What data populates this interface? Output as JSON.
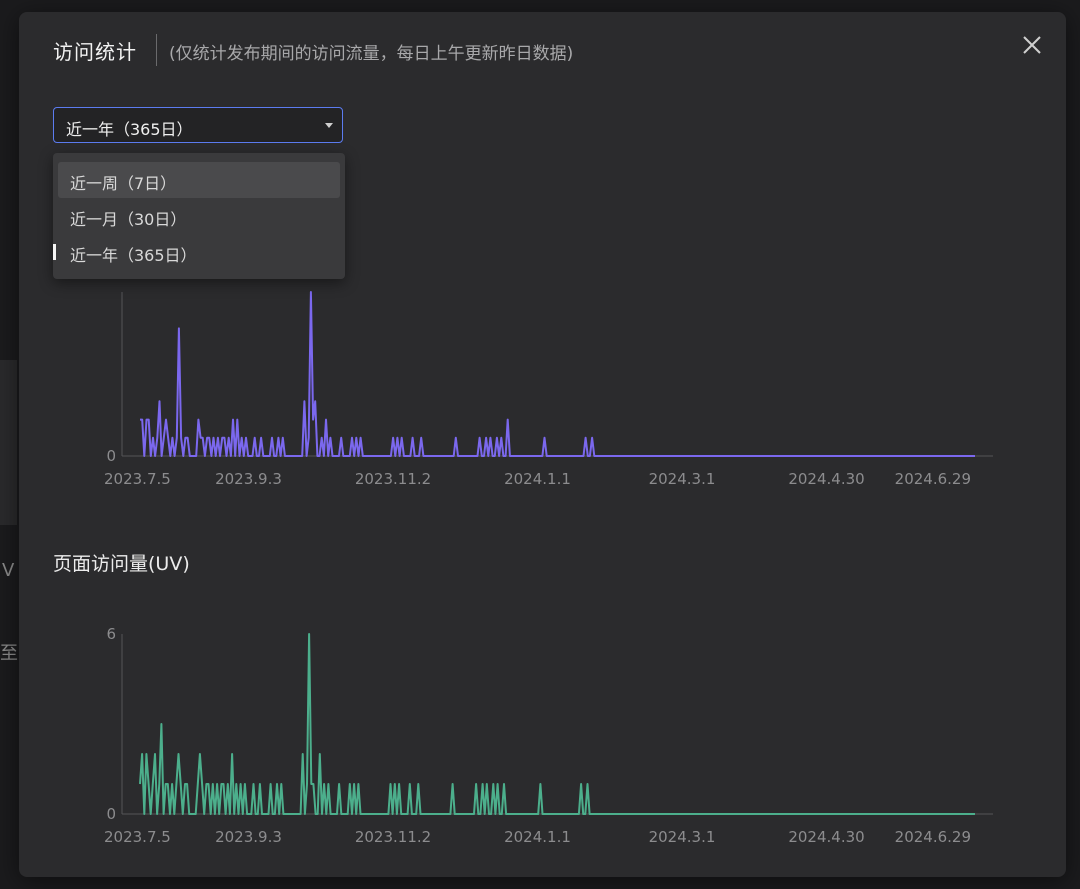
{
  "modal": {
    "title": "访问统计",
    "subtitle": "(仅统计发布期间的访问流量，每日上午更新昨日数据)"
  },
  "range_select": {
    "value": "近一年（365日）",
    "options": [
      "近一周（7日）",
      "近一月（30日）",
      "近一年（365日）"
    ]
  },
  "background_text": {
    "left_a": "V",
    "left_b": "至"
  },
  "uv_section_title": "页面访问量(UV)",
  "colors": {
    "pv_line": "#7b68ee",
    "uv_line": "#4caf8c",
    "select_border": "#5c7cf0"
  },
  "chart_data": [
    {
      "type": "line",
      "x_tick_labels": [
        "2023.7.5",
        "2023.9.3",
        "2023.11.2",
        "2024.1.1",
        "2024.3.1",
        "2024.4.30",
        "2024.6.29"
      ],
      "y_tick_labels": [
        "0"
      ],
      "ylim": [
        0,
        9
      ],
      "series": [
        {
          "values": [
            2,
            2,
            0,
            2,
            2,
            0,
            1,
            0,
            1,
            3,
            0,
            1,
            2,
            1,
            0,
            1,
            0,
            1,
            7,
            1,
            0,
            1,
            1,
            0,
            0,
            0,
            0,
            2,
            1,
            1,
            0,
            1,
            1,
            0,
            1,
            0,
            1,
            0,
            1,
            1,
            0,
            1,
            0,
            2,
            0,
            2,
            0,
            1,
            0,
            1,
            0,
            0,
            0,
            1,
            0,
            0,
            1,
            0,
            0,
            0,
            0,
            1,
            0,
            0,
            1,
            0,
            1,
            0,
            0,
            0,
            0,
            0,
            0,
            0,
            0,
            0,
            3,
            0,
            1,
            9,
            2,
            3,
            0,
            0,
            1,
            0,
            2,
            0,
            1,
            0,
            0,
            0,
            0,
            1,
            0,
            0,
            0,
            0,
            1,
            0,
            1,
            0,
            1,
            0,
            0,
            0,
            0,
            0,
            0,
            0,
            0,
            0,
            0,
            0,
            0,
            0,
            0,
            1,
            0,
            1,
            0,
            1,
            0,
            0,
            0,
            0,
            1,
            0,
            0,
            0,
            1,
            0,
            0,
            0,
            0,
            0,
            0,
            0,
            0,
            0,
            0,
            0,
            0,
            0,
            0,
            0,
            1,
            0,
            0,
            0,
            0,
            0,
            0,
            0,
            0,
            0,
            0,
            1,
            0,
            0,
            1,
            0,
            1,
            0,
            0,
            1,
            0,
            1,
            0,
            0,
            2,
            0,
            0,
            0,
            0,
            0,
            0,
            0,
            0,
            0,
            0,
            0,
            0,
            0,
            0,
            0,
            0,
            1,
            0,
            0,
            0,
            0,
            0,
            0,
            0,
            0,
            0,
            0,
            0,
            0,
            0,
            0,
            0,
            0,
            0,
            0,
            1,
            0,
            0,
            1,
            0,
            0,
            0,
            0,
            0,
            0,
            0,
            0,
            0,
            0,
            0,
            0,
            0,
            0,
            0,
            0,
            0,
            0,
            0,
            0,
            0,
            0,
            0,
            0,
            0,
            0,
            0,
            0,
            0,
            0,
            0,
            0,
            0,
            0,
            0,
            0,
            0,
            0,
            0,
            0,
            0,
            0,
            0,
            0,
            0,
            0,
            0,
            0,
            0,
            0,
            0,
            0,
            0,
            0,
            0,
            0,
            0,
            0,
            0,
            0,
            0,
            0,
            0,
            0,
            0,
            0,
            0,
            0,
            0,
            0,
            0,
            0,
            0,
            0,
            0,
            0,
            0,
            0,
            0,
            0,
            0,
            0,
            0,
            0,
            0,
            0,
            0,
            0,
            0,
            0,
            0,
            0,
            0,
            0,
            0,
            0,
            0,
            0,
            0,
            0,
            0,
            0,
            0,
            0,
            0,
            0,
            0,
            0,
            0,
            0,
            0,
            0,
            0,
            0,
            0,
            0,
            0,
            0,
            0,
            0,
            0,
            0,
            0,
            0,
            0,
            0,
            0,
            0,
            0,
            0,
            0,
            0,
            0,
            0,
            0,
            0,
            0,
            0,
            0,
            0,
            0,
            0,
            0,
            0,
            0,
            0,
            0,
            0,
            0,
            0,
            0,
            0,
            0,
            0,
            0,
            0,
            0,
            0,
            0,
            0,
            0,
            0,
            0,
            0,
            0,
            0,
            0,
            0,
            0,
            0,
            0,
            0,
            0,
            0,
            0,
            0,
            0
          ]
        }
      ],
      "x": {
        "start": "2023-07-05",
        "end": "2024-06-29"
      }
    },
    {
      "type": "line",
      "x_tick_labels": [
        "2023.7.5",
        "2023.9.3",
        "2023.11.2",
        "2024.1.1",
        "2024.3.1",
        "2024.4.30",
        "2024.6.29"
      ],
      "y_tick_labels": [
        "0",
        "6"
      ],
      "ylim": [
        0,
        6
      ],
      "series": [
        {
          "values": [
            1,
            2,
            0,
            2,
            1,
            0,
            1,
            2,
            0,
            1,
            3,
            0,
            1,
            1,
            0,
            1,
            0,
            1,
            2,
            1,
            0,
            1,
            1,
            0,
            0,
            0,
            0,
            1,
            2,
            1,
            0,
            1,
            1,
            0,
            1,
            0,
            1,
            0,
            1,
            1,
            0,
            1,
            0,
            2,
            0,
            1,
            0,
            1,
            0,
            1,
            0,
            0,
            0,
            1,
            0,
            0,
            1,
            0,
            0,
            0,
            0,
            1,
            0,
            0,
            1,
            0,
            1,
            0,
            0,
            0,
            0,
            0,
            0,
            0,
            0,
            0,
            2,
            0,
            1,
            6,
            1,
            1,
            0,
            0,
            2,
            0,
            1,
            0,
            1,
            0,
            0,
            0,
            0,
            1,
            0,
            0,
            0,
            0,
            1,
            0,
            1,
            0,
            1,
            0,
            0,
            0,
            0,
            0,
            0,
            0,
            0,
            0,
            0,
            0,
            0,
            0,
            0,
            1,
            0,
            1,
            0,
            1,
            0,
            0,
            0,
            0,
            1,
            0,
            0,
            0,
            1,
            0,
            0,
            0,
            0,
            0,
            0,
            0,
            0,
            0,
            0,
            0,
            0,
            0,
            0,
            0,
            1,
            0,
            0,
            0,
            0,
            0,
            0,
            0,
            0,
            0,
            0,
            1,
            0,
            0,
            1,
            0,
            1,
            0,
            0,
            1,
            0,
            1,
            0,
            0,
            1,
            0,
            0,
            0,
            0,
            0,
            0,
            0,
            0,
            0,
            0,
            0,
            0,
            0,
            0,
            0,
            0,
            1,
            0,
            0,
            0,
            0,
            0,
            0,
            0,
            0,
            0,
            0,
            0,
            0,
            0,
            0,
            0,
            0,
            0,
            0,
            1,
            0,
            0,
            1,
            0,
            0,
            0,
            0,
            0,
            0,
            0,
            0,
            0,
            0,
            0,
            0,
            0,
            0,
            0,
            0,
            0,
            0,
            0,
            0,
            0,
            0,
            0,
            0,
            0,
            0,
            0,
            0,
            0,
            0,
            0,
            0,
            0,
            0,
            0,
            0,
            0,
            0,
            0,
            0,
            0,
            0,
            0,
            0,
            0,
            0,
            0,
            0,
            0,
            0,
            0,
            0,
            0,
            0,
            0,
            0,
            0,
            0,
            0,
            0,
            0,
            0,
            0,
            0,
            0,
            0,
            0,
            0,
            0,
            0,
            0,
            0,
            0,
            0,
            0,
            0,
            0,
            0,
            0,
            0,
            0,
            0,
            0,
            0,
            0,
            0,
            0,
            0,
            0,
            0,
            0,
            0,
            0,
            0,
            0,
            0,
            0,
            0,
            0,
            0,
            0,
            0,
            0,
            0,
            0,
            0,
            0,
            0,
            0,
            0,
            0,
            0,
            0,
            0,
            0,
            0,
            0,
            0,
            0,
            0,
            0,
            0,
            0,
            0,
            0,
            0,
            0,
            0,
            0,
            0,
            0,
            0,
            0,
            0,
            0,
            0,
            0,
            0,
            0,
            0,
            0,
            0,
            0,
            0,
            0,
            0,
            0,
            0,
            0,
            0,
            0,
            0,
            0,
            0,
            0,
            0,
            0,
            0,
            0,
            0,
            0,
            0,
            0,
            0,
            0,
            0,
            0,
            0,
            0,
            0,
            0,
            0,
            0,
            0,
            0,
            0,
            0,
            0,
            0,
            0,
            0
          ]
        }
      ],
      "x": {
        "start": "2023-07-05",
        "end": "2024-06-29"
      }
    }
  ]
}
